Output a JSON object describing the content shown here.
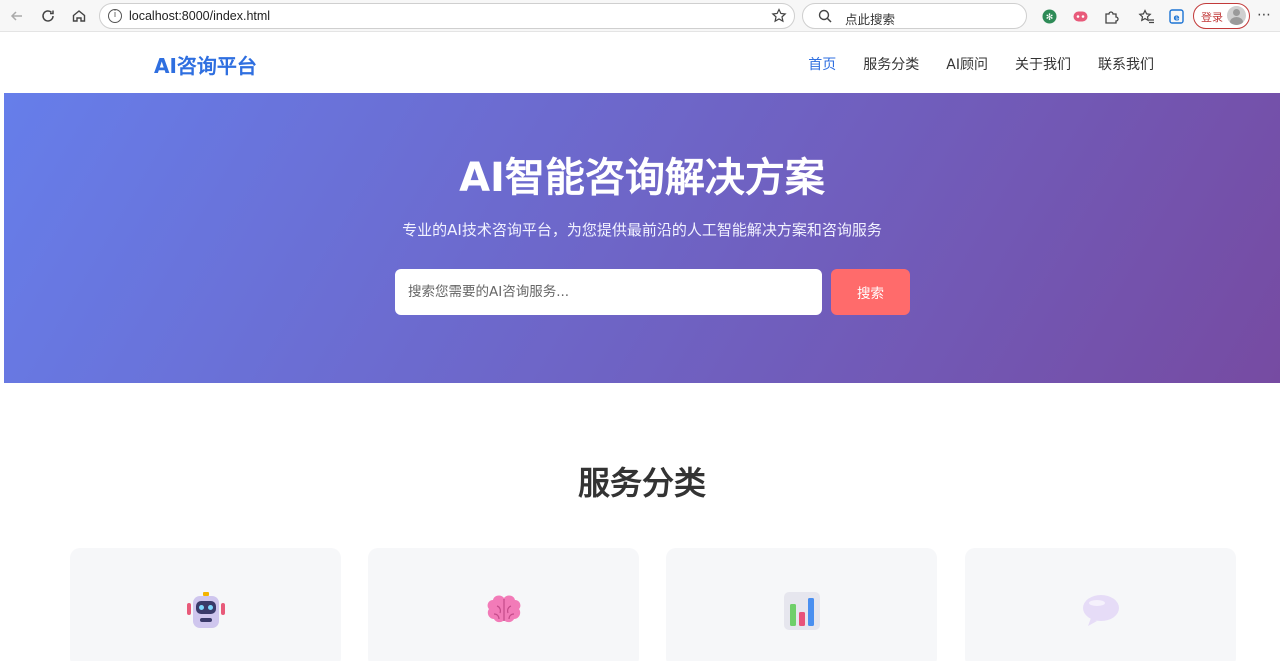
{
  "browser": {
    "url": "localhost:8000/index.html",
    "search_placeholder": "点此搜索",
    "login_label": "登录"
  },
  "site": {
    "logo": "AI咨询平台",
    "nav": [
      "首页",
      "服务分类",
      "AI顾问",
      "关于我们",
      "联系我们"
    ],
    "active_nav": "首页"
  },
  "hero": {
    "title": "AI智能咨询解决方案",
    "subtitle": "专业的AI技术咨询平台，为您提供最前沿的人工智能解决方案和咨询服务",
    "search_placeholder": "搜索您需要的AI咨询服务...",
    "search_button": "搜索"
  },
  "services": {
    "title": "服务分类",
    "cards": [
      {
        "icon": "robot-icon"
      },
      {
        "icon": "brain-icon"
      },
      {
        "icon": "bar-chart-icon"
      },
      {
        "icon": "speech-bubble-icon"
      }
    ]
  },
  "colors": {
    "brand_blue": "#2f6fe0",
    "hero_gradient_start": "#667eea",
    "hero_gradient_end": "#764ba2",
    "search_button": "#ff6b6b"
  }
}
